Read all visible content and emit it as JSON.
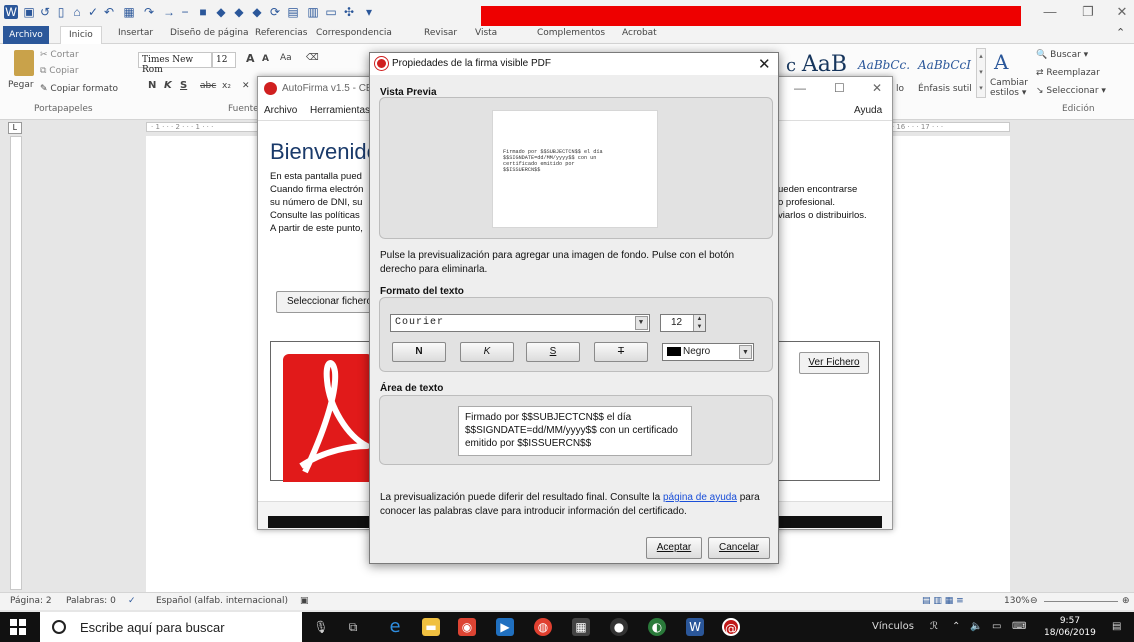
{
  "word": {
    "tabs": [
      "Archivo",
      "Inicio",
      "Insertar",
      "Diseño de página",
      "Referencias",
      "Correspondencia",
      "Revisar",
      "Vista",
      "Complementos",
      "Acrobat"
    ],
    "clipboard": {
      "cut": "Cortar",
      "copy": "Copiar",
      "paste": "Pegar",
      "format_painter": "Copiar formato",
      "group": "Portapapeles"
    },
    "font": {
      "name": "Times New Rom",
      "size": "12",
      "group": "Fuente",
      "size_up": "A",
      "size_down": "A",
      "case": "Aa",
      "bold": "N",
      "italic": "K",
      "underline": "S",
      "strike": "abc",
      "subscript": "x₂",
      "clear": "✕"
    },
    "styles": {
      "sample_big": "AaB",
      "sample1": "AaBbCc.",
      "sample2": "AaBbCcI",
      "label_partial": "lo",
      "emphasis": "Énfasis sutil",
      "change_styles_1": "Cambiar",
      "change_styles_2": "estilos"
    },
    "editing": {
      "find": "Buscar",
      "replace": "Reemplazar",
      "select": "Seleccionar",
      "group": "Edición"
    },
    "ruler": "· 1 · · · 2 · · · 1 · · ·",
    "ruler_right": "· · · 16 · · · 17 · · ·",
    "status": {
      "page": "Página: 2",
      "words": "Palabras: 0",
      "language": "Español (alfab. internacional)",
      "zoom": "130%"
    }
  },
  "taskbar": {
    "search_placeholder": "Escribe aquí para buscar",
    "links": "Vínculos",
    "time": "9:57",
    "date": "18/06/2019"
  },
  "autofirma": {
    "title": "AutoFirma v1.5 - CE",
    "menu": {
      "archivo": "Archivo",
      "herramientas": "Herramientas",
      "ayuda": "Ayuda"
    },
    "heading": "Bienvenido",
    "lines": [
      "En esta pantalla pued",
      "Cuando firma electrón",
      "su número de DNI, su",
      "Consulte las políticas",
      "A partir de este punto,"
    ],
    "lines_right": [
      "ueden encontrarse",
      "o profesional.",
      "viarlos o distribuirlos."
    ],
    "select_button": "Seleccionar fichero",
    "view_button": "Ver Fichero"
  },
  "dialog": {
    "title": "Propiedades de la firma visible PDF",
    "preview_title": "Vista Previa",
    "preview_text": "Firmado por $$SUBJECTCN$$ el día\n$$SIGNDATE=dd/MM/yyyy$$ con un\ncertificado emitido por\n$$ISSUERCN$$",
    "preview_hint": "Pulse la previsualización para agregar una imagen de fondo. Pulse con el botón derecho para eliminarla.",
    "format_title": "Formato del texto",
    "font_value": "Courier",
    "size_value": "12",
    "bold_label": "N",
    "italic_label": "K",
    "underline_label": "S",
    "strike_label": "T",
    "color_value": "Negro",
    "color_swatch": "#000000",
    "textarea_title": "Área de texto",
    "textarea_value": "Firmado por $$SUBJECTCN$$ el día $$SIGNDATE=dd/MM/yyyy$$ con un certificado emitido por $$ISSUERCN$$",
    "footer_text_before": "La previsualización puede diferir del resultado final. Consulte la ",
    "footer_link": "página de ayuda",
    "footer_text_after": " para conocer las palabras clave para introducir información del certificado.",
    "accept": "Aceptar",
    "cancel": "Cancelar"
  }
}
